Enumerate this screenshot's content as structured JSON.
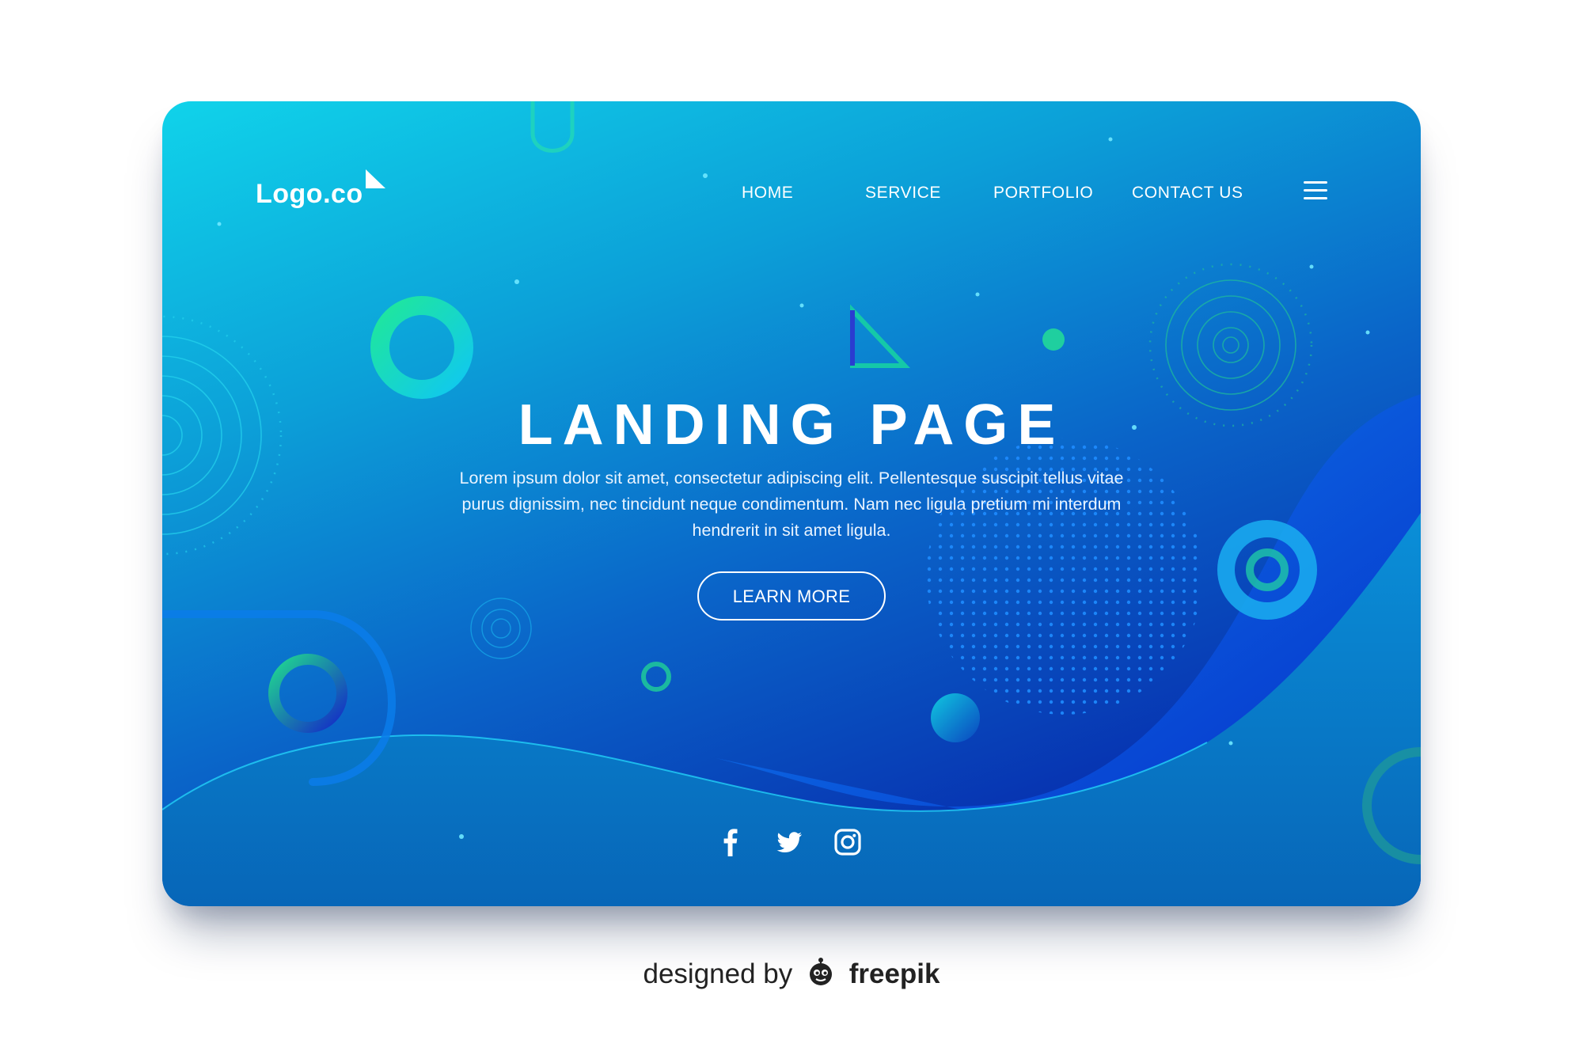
{
  "header": {
    "logo_text": "Logo.co",
    "nav": [
      "HOME",
      "SERVICE",
      "PORTFOLIO",
      "CONTACT US"
    ]
  },
  "hero": {
    "title": "LANDING PAGE",
    "text": "Lorem ipsum dolor sit amet, consectetur adipiscing elit. Pellentesque suscipit tellus vitae purus dignissim, nec tincidunt neque condimentum. Nam nec ligula pretium mi interdum hendrerit in sit amet ligula.",
    "button": "LEARN MORE"
  },
  "social_icons": [
    "facebook-icon",
    "twitter-icon",
    "instagram-icon"
  ],
  "credit": {
    "prefix": "designed by",
    "brand": "freepik"
  },
  "colors": {
    "gradient_start": "#10d3ea",
    "gradient_end": "#08279a",
    "accent_green": "#1fe0a0",
    "text": "#ffffff"
  }
}
